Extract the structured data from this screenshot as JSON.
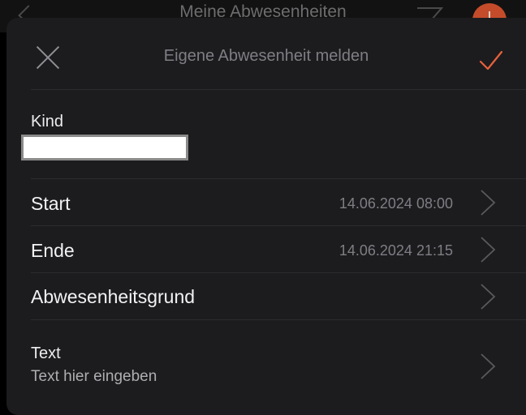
{
  "background": {
    "title": "Meine Abwesenheiten"
  },
  "header": {
    "title": "Eigene Abwesenheit melden"
  },
  "kind": {
    "label": "Kind",
    "value": ""
  },
  "rows": [
    {
      "label": "Start",
      "value": "14.06.2024 08:00"
    },
    {
      "label": "Ende",
      "value": "14.06.2024 21:15"
    },
    {
      "label": "Abwesenheitsgrund",
      "value": ""
    }
  ],
  "text_field": {
    "label": "Text",
    "placeholder": "Text hier eingeben"
  },
  "colors": {
    "accent": "#e8613c",
    "sheet": "#1c1c1e",
    "divider": "#2c2c2e"
  }
}
